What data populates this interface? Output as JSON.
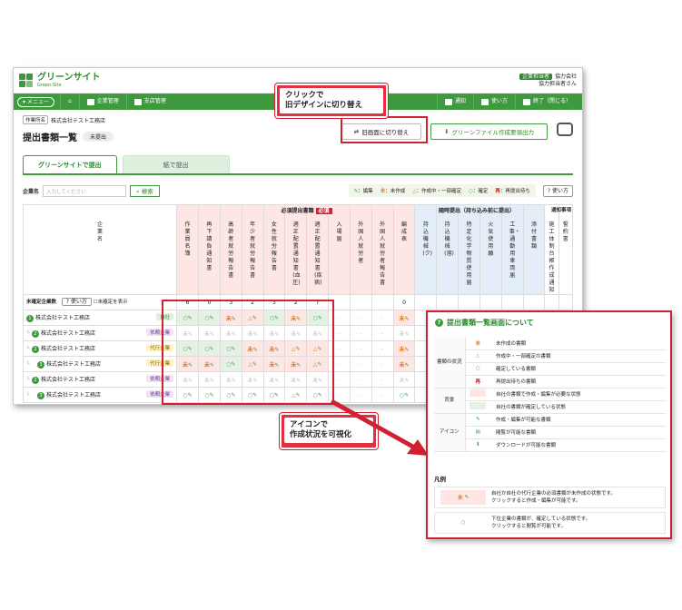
{
  "app": {
    "logo_title": "グリーンサイト",
    "logo_sub": "Green-Site",
    "role_badge": "企業担当者",
    "company_label": "協力会社",
    "user_name": "協力担当者さん"
  },
  "nav": {
    "menu": "メニュー",
    "company_mgmt": "企業管理",
    "branch_mgmt": "支店管理",
    "notice": "通知",
    "howto": "使い方",
    "logout": "終了（閉じる）"
  },
  "page": {
    "site_label": "作業所名",
    "site_name": "株式会社テスト工務店",
    "title": "提出書類一覧",
    "status_badge": "未提出",
    "switch_button": "旧画面に切り替え",
    "manual_button": "グリーンファイル作成要領出力"
  },
  "tabs": [
    {
      "label": "グリーンサイトで提出"
    },
    {
      "label": "紙で提出"
    }
  ],
  "filter": {
    "company_label": "企業名",
    "placeholder": "入力してください",
    "search_button": "検索",
    "legend_edit": "：編集",
    "legend_not": "：未作成",
    "legend_partial": "：作成中・一部確定",
    "legend_done": "：確定",
    "legend_resubmit": "：再提出待ち",
    "help_button": "使い方"
  },
  "table": {
    "company_header": "企業名",
    "group_required": "必須提出書類",
    "required_badge": "必須",
    "group_optional": "随時提出（持ち込み前に提出）",
    "group_notice": "通知事項",
    "columns_required": [
      "作業員名簿",
      "再下請負通知書",
      "高齢者就労報告書",
      "年少者就労報告書",
      "女性就労報告書",
      "適正配置通知書(血圧)",
      "適正配置通知書(疾病)",
      "入場届",
      "外国人就労者",
      "外国人就労者報告書",
      "編成表"
    ],
    "columns_optional": [
      "持込機械(ク)",
      "持込機械(溶)",
      "特定化学物質使用届",
      "火気使用願",
      "工事・通勤用車両届",
      "添付書類"
    ],
    "columns_notice": [
      "施工体制台帳作成通知",
      "誓約書"
    ],
    "unconfirmed_label": "未確定企業数",
    "help_button": "使い方",
    "unconfirmed_toggle": "未確定を表示",
    "counts": [
      "6",
      "0",
      "3",
      "2",
      "3",
      "2",
      "7",
      "",
      "",
      "",
      "0"
    ],
    "rows": [
      {
        "num": "1",
        "indent": 0,
        "name": "株式会社テスト工務店",
        "tag": "自社",
        "tag_type": "own"
      },
      {
        "num": "2",
        "indent": 1,
        "name": "株式会社テスト工務店",
        "tag": "依頼企業",
        "tag_type": "req"
      },
      {
        "num": "2",
        "indent": 1,
        "name": "株式会社テスト工務店",
        "tag": "代行企業",
        "tag_type": "agent"
      },
      {
        "num": "3",
        "indent": 2,
        "name": "株式会社テスト工務店",
        "tag": "代行企業",
        "tag_type": "agent"
      },
      {
        "num": "2",
        "indent": 1,
        "name": "株式会社テスト工務店",
        "tag": "依頼企業",
        "tag_type": "req"
      },
      {
        "num": "3",
        "indent": 2,
        "name": "株式会社テスト工務店",
        "tag": "依頼企業",
        "tag_type": "req"
      }
    ]
  },
  "callouts": {
    "switch_note_line1": "クリックで",
    "switch_note_line2": "旧デザインに切り替え",
    "icon_note_line1": "アイコンで",
    "icon_note_line2": "作成状況を可視化"
  },
  "help_panel": {
    "title": "提出書類一覧画面について",
    "cat_status": "書類の状況",
    "cat_background": "背景",
    "cat_icon": "アイコン",
    "status_items": [
      {
        "symbol": "未",
        "text": "未作成の書類"
      },
      {
        "symbol": "△",
        "text": "作成中・一部確定の書類"
      },
      {
        "symbol": "○",
        "text": "確定している書類"
      },
      {
        "symbol": "再",
        "text": "再提出待ちの書類"
      }
    ],
    "background_items": [
      {
        "color": "#fde6e4",
        "text": "自社の書類で作成・編集が必要な状態"
      },
      {
        "color": "#e6f1e6",
        "text": "自社の書類が確定している状態"
      }
    ],
    "icon_items": [
      {
        "icon": "pencil-icon",
        "text": "作成・編集が可能な書類"
      },
      {
        "icon": "view-icon",
        "text": "閲覧が可能な書類"
      },
      {
        "icon": "download-icon",
        "text": "ダウンロードが可能な書類"
      }
    ],
    "examples_title": "凡例",
    "example1_line1": "自社か自社の代行企業の必須書類が未作成の状態です。",
    "example1_line2": "クリックすると作成・編集が可能です。",
    "example2_line1": "下位企業の書類が、確定している状態です。",
    "example2_line2": "クリックすると閲覧が可能です。"
  },
  "colors": {
    "brand_green": "#3f9a3f",
    "accent_red": "#d32030",
    "pending_orange": "#e07a20"
  }
}
